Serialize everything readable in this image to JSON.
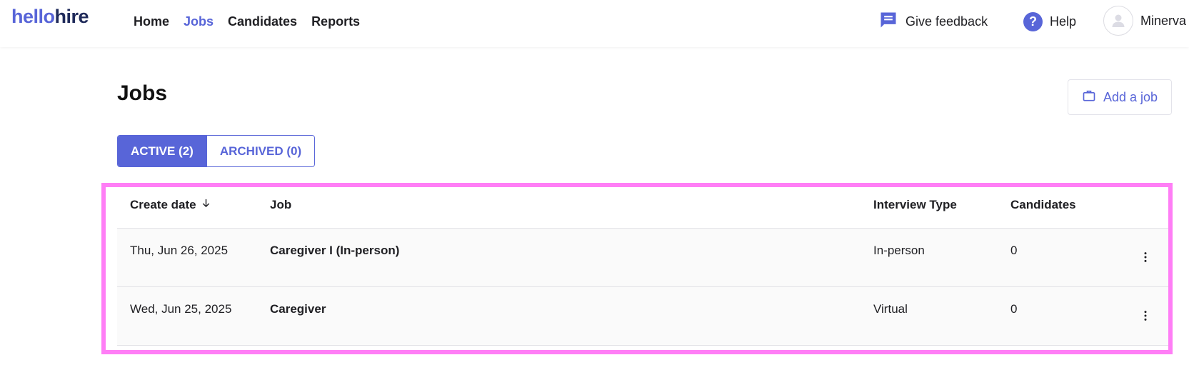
{
  "app": {
    "logo_part1": "hello",
    "logo_part2": "hire",
    "brand_color": "#5865d8"
  },
  "nav": {
    "items": [
      {
        "label": "Home",
        "active": false
      },
      {
        "label": "Jobs",
        "active": true
      },
      {
        "label": "Candidates",
        "active": false
      },
      {
        "label": "Reports",
        "active": false
      }
    ]
  },
  "header_actions": {
    "feedback_label": "Give feedback",
    "feedback_icon": "chat-bubble-icon",
    "help_label": "Help",
    "help_icon": "question-circle-icon",
    "user_name": "Minerva",
    "user_icon": "person-avatar-icon"
  },
  "page": {
    "title": "Jobs",
    "add_job_label": "Add a job",
    "add_job_icon": "briefcase-icon"
  },
  "tabs": [
    {
      "label": "ACTIVE (2)",
      "active": true
    },
    {
      "label": "ARCHIVED (0)",
      "active": false
    }
  ],
  "table": {
    "columns": [
      "Create date",
      "Job",
      "Interview Type",
      "Candidates"
    ],
    "sort_icon": "arrow-down-icon",
    "rows": [
      {
        "create_date": "Thu, Jun 26, 2025",
        "job": "Caregiver I (In-person)",
        "interview_type": "In-person",
        "candidates": "0"
      },
      {
        "create_date": "Wed, Jun 25, 2025",
        "job": "Caregiver",
        "interview_type": "Virtual",
        "candidates": "0"
      }
    ],
    "row_menu_icon": "more-vertical-icon"
  },
  "highlight_color": "#ff7ef6"
}
